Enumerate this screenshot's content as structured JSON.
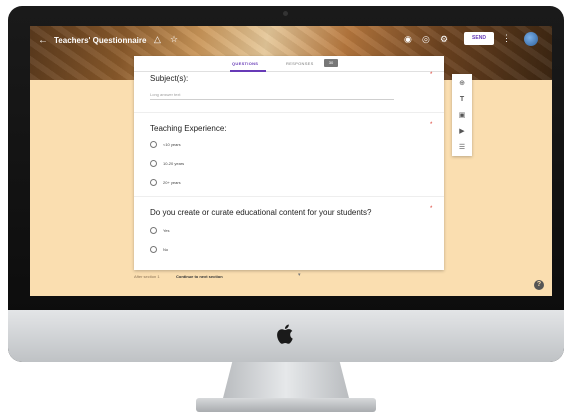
{
  "app": {
    "form_title": "Teachers' Questionnaire",
    "send_label": "SEND",
    "icons": {
      "back": "arrow-left-icon",
      "palette": "palette-icon",
      "star": "star-icon",
      "theme": "color-palette-icon",
      "preview": "eye-icon",
      "settings": "gear-icon",
      "more": "more-vert-icon"
    }
  },
  "tabs": {
    "questions": "QUESTIONS",
    "responses": "RESPONSES",
    "responses_count": "30"
  },
  "questions": [
    {
      "title": "Subject(s):",
      "type": "short-answer",
      "placeholder": "Long answer text",
      "required": true
    },
    {
      "title": "Teaching Experience:",
      "type": "multiple-choice",
      "required": true,
      "options": [
        "<10 years",
        "10-20 years",
        "20+ years"
      ]
    },
    {
      "title": "Do you create or curate educational content for your students?",
      "type": "multiple-choice",
      "required": true,
      "options": [
        "Yes",
        "No"
      ]
    }
  ],
  "after_section": {
    "label": "After section 1",
    "value": "Continue to next section"
  },
  "colors": {
    "background": "#fadeb0",
    "accent": "#673ab7",
    "required": "#d93025"
  }
}
